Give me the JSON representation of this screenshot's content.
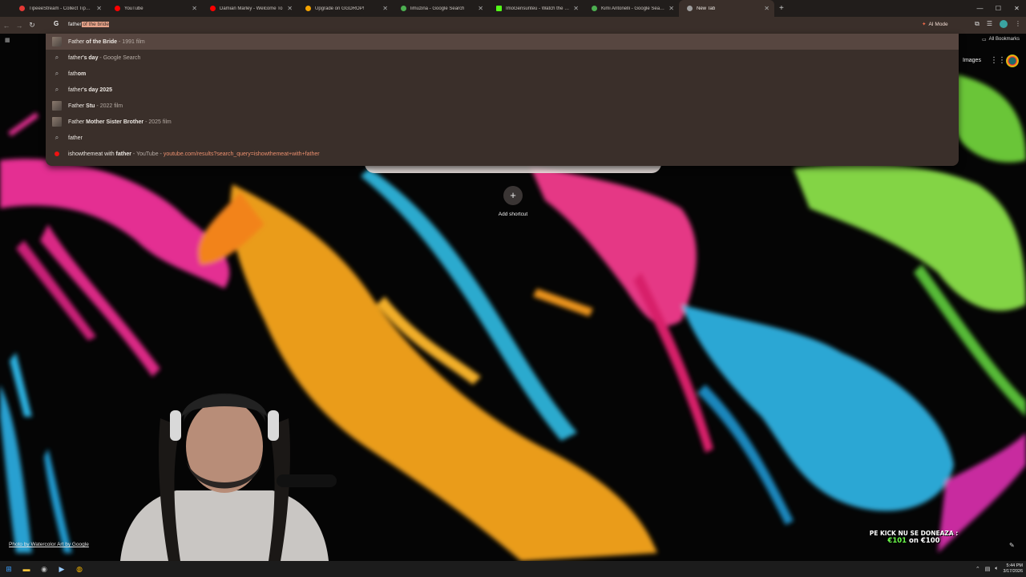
{
  "tabs": [
    {
      "title": "TipeeeStream - Collect Tips with",
      "favicon_color": "#e53935",
      "active": false
    },
    {
      "title": "YouTube",
      "favicon_color": "#ff0000",
      "active": false
    },
    {
      "title": "Damian Marley - Welcome To",
      "favicon_color": "#ff0000",
      "active": false
    },
    {
      "title": "Upgrade on GGDROP!",
      "favicon_color": "#f4a300",
      "active": false
    },
    {
      "title": "limuzina - Google Search",
      "favicon_color": "#4caf50",
      "active": false
    },
    {
      "title": "ImoGensunteu - Watch the VOD",
      "favicon_color": "#53fc18",
      "active": false
    },
    {
      "title": "Kimi Antonelli - Google Search",
      "favicon_color": "#4caf50",
      "active": false
    },
    {
      "title": "New Tab",
      "favicon_color": "#9e9e9e",
      "active": true
    }
  ],
  "toolbar": {
    "typed": "father",
    "autocomplete": " of the bride",
    "ai_mode": "AI Mode"
  },
  "bookmarks": {
    "all_label": "All Bookmarks"
  },
  "suggestions": [
    {
      "icon": "thumb",
      "bold_first": false,
      "pre": "Father",
      "bold": " of the Bride",
      "meta": " - 1991 film",
      "url": "",
      "highlighted": true
    },
    {
      "icon": "search",
      "pre": "father",
      "bold": "'s day",
      "meta": " - Google Search",
      "url": ""
    },
    {
      "icon": "search",
      "pre": "fath",
      "bold": "om",
      "meta": "",
      "url": ""
    },
    {
      "icon": "search",
      "pre": "father",
      "bold": "'s day 2025",
      "meta": "",
      "url": ""
    },
    {
      "icon": "thumb",
      "pre": "Father",
      "bold": " Stu",
      "meta": " - 2022 film",
      "url": ""
    },
    {
      "icon": "thumb",
      "pre": "Father",
      "bold": " Mother Sister Brother",
      "meta": " - 2025 film",
      "url": ""
    },
    {
      "icon": "search",
      "pre": "father",
      "bold": "",
      "meta": "",
      "url": ""
    },
    {
      "icon": "youtube",
      "pre": "ishowthemeat with ",
      "bold": "father",
      "meta": " - YouTube - ",
      "url": "youtube.com/results?search_query=ishowthemeat+with+father"
    }
  ],
  "ntp": {
    "images_link": "Images",
    "add_shortcut": "Add shortcut",
    "photo_credit": "Photo by Watercolor Art by Google"
  },
  "overlay": {
    "donation_line1": "PE KICK NU SE DONEAZA :",
    "donation_amount": "€101",
    "donation_rest": " on €100"
  },
  "taskbar": {
    "time": "5:44 PM",
    "date": "3/17/2026"
  }
}
